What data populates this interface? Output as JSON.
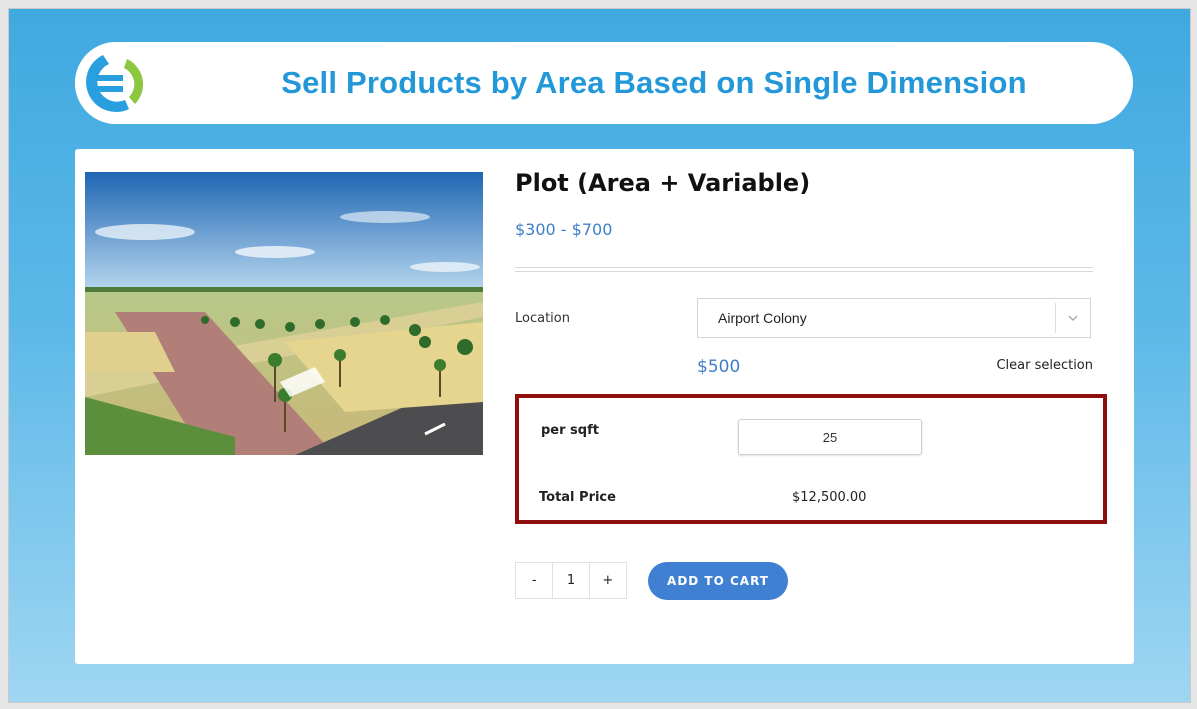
{
  "banner": {
    "title": "Sell Products by Area Based on Single Dimension",
    "logo_icon": "brand-logo-icon"
  },
  "product": {
    "title": "Plot (Area + Variable)",
    "price_range": "$300 - $700",
    "image_icon": "land-plot-image"
  },
  "variations": {
    "location_label": "Location",
    "location_selected": "Airport Colony",
    "variation_price": "$500",
    "clear_selection": "Clear selection"
  },
  "area_calc": {
    "per_sqft_label": "per sqft",
    "per_sqft_value": "25",
    "total_label": "Total Price",
    "total_value": "$12,500.00"
  },
  "cart": {
    "minus": "-",
    "quantity": "1",
    "plus": "+",
    "add_to_cart": "ADD TO CART"
  },
  "colors": {
    "accent_blue": "#3f80d2",
    "price_blue": "#3f7fc9",
    "title_blue": "#2398d8",
    "highlight_border": "#8e0d0d",
    "logo_green": "#8dc63f"
  }
}
